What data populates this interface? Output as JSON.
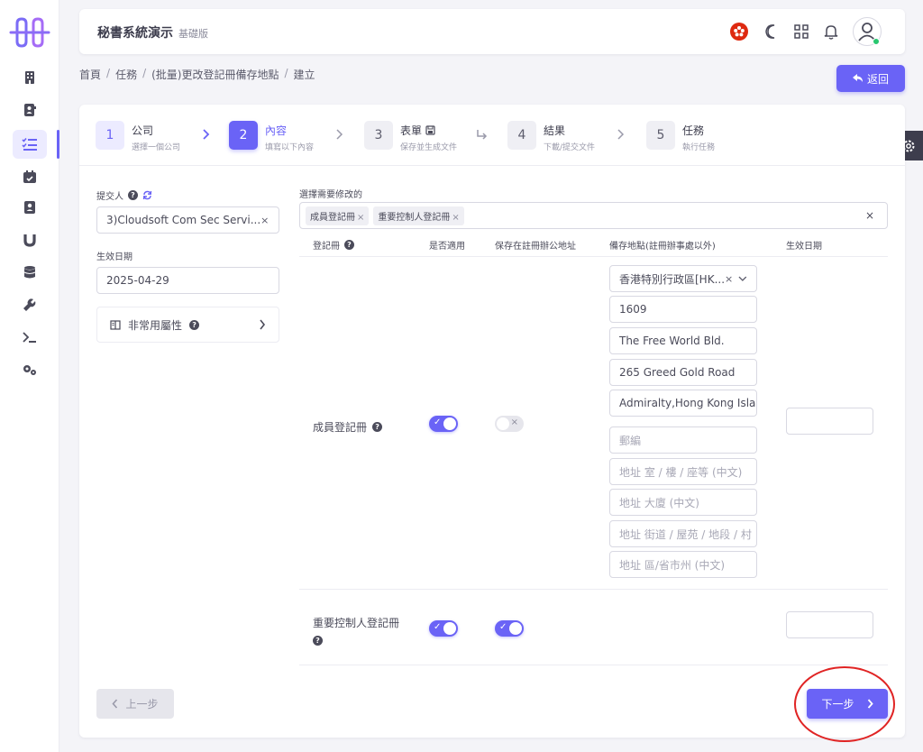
{
  "colors": {
    "accent": "#6a63f6",
    "annotation": "#e02424",
    "online": "#28c76f"
  },
  "header": {
    "title": "秘書系統演示",
    "edition": "基礎版",
    "icons": [
      "hk-flag-icon",
      "moon-icon",
      "apps-grid-icon",
      "bell-icon",
      "user-avatar-icon"
    ]
  },
  "sidebar": {
    "items": [
      "building-icon",
      "contact-card-icon",
      "task-list-icon",
      "calendar-check-icon",
      "address-book-icon",
      "magnet-icon",
      "database-icon",
      "wrench-icon",
      "terminal-icon",
      "gears-icon"
    ],
    "active": "task-list-icon"
  },
  "breadcrumb": [
    "首頁",
    "任務",
    "(批量)更改登記冊備存地點",
    "建立"
  ],
  "back_label": "返回",
  "steps": [
    {
      "num": "1",
      "title": "公司",
      "sub": "選擇一個公司",
      "state": "done"
    },
    {
      "num": "2",
      "title": "內容",
      "sub": "填寫以下內容",
      "state": "current"
    },
    {
      "num": "3",
      "title": "表單",
      "sub": "保存並生成文件",
      "state": "todo"
    },
    {
      "num": "4",
      "title": "結果",
      "sub": "下載/提交文件",
      "state": "todo"
    },
    {
      "num": "5",
      "title": "任務",
      "sub": "執行任務",
      "state": "todo"
    }
  ],
  "form": {
    "submitter_label": "提交人",
    "submitter_value": "3)Cloudsoft Com Sec Servi...",
    "effective_date_label": "生效日期",
    "effective_date_value": "2025-04-29",
    "uncommon_label": "非常用屬性"
  },
  "registers": {
    "select_label": "選擇需要修改的",
    "tags": [
      "成員登記冊",
      "重要控制人登記冊"
    ],
    "columns": [
      "登記冊",
      "是否適用",
      "保存在註冊辦公地址",
      "備存地點(註冊辦事處以外)",
      "生效日期"
    ],
    "rows": [
      {
        "name": "成員登記冊",
        "applicable": true,
        "at_office": false,
        "effective_date": ""
      },
      {
        "name": "重要控制人登記冊",
        "applicable": true,
        "at_office": true,
        "effective_date": ""
      }
    ],
    "address": {
      "region": "香港特別行政區[HK...",
      "values": [
        "1609",
        "The Free World Bld.",
        "265 Greed Gold Road",
        "Admiralty,Hong Kong Islan"
      ],
      "placeholders": [
        "郵編",
        "地址 室 / 樓 / 座等 (中文)",
        "地址 大廈 (中文)",
        "地址 街道 / 屋苑 / 地段 / 村",
        "地址 區/省市州 (中文)"
      ]
    }
  },
  "nav": {
    "prev_label": "上一步",
    "next_label": "下一步"
  }
}
